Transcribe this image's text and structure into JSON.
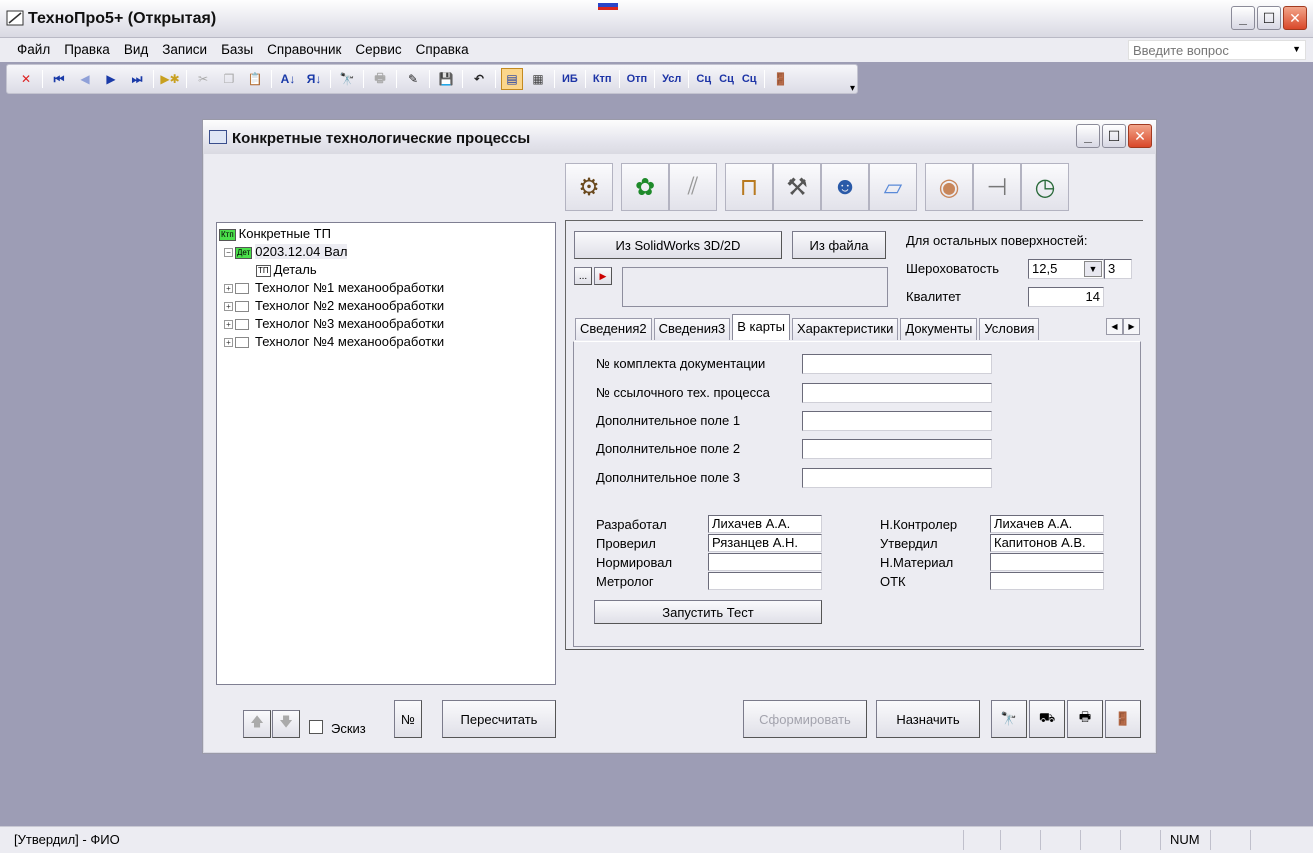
{
  "app": {
    "title": "ТехноПро5+ (Открытая)"
  },
  "menu": {
    "items": [
      "Файл",
      "Правка",
      "Вид",
      "Записи",
      "Базы",
      "Справочник",
      "Сервис",
      "Справка"
    ],
    "ask_placeholder": "Введите вопрос"
  },
  "toolbar": {
    "text_buttons": [
      "ИБ",
      "Ктп",
      "Отп",
      "Усл",
      "Сц",
      "Сц",
      "Сц"
    ]
  },
  "child": {
    "title": "Конкретные технологические процессы",
    "header_icons": [
      "part-icon",
      "gear-icon",
      "pipes-icon",
      "workbench-icon",
      "machine-icon",
      "worker-icon",
      "paper-icon",
      "roll-icon",
      "caliper-icon",
      "clock-icon"
    ]
  },
  "tree": {
    "root": {
      "badge": "Ктп",
      "label": "Конкретные ТП"
    },
    "detail": {
      "badge": "Дет",
      "label": "0203.12.04 Вал"
    },
    "tp": {
      "badge": "ТП",
      "label": "Деталь"
    },
    "technologists": [
      "Технолог №1 механообработки",
      "Технолог №2 механообработки",
      "Технолог №3 механообработки",
      "Технолог №4 механообработки"
    ]
  },
  "panel": {
    "from_solidworks": "Из SolidWorks 3D/2D",
    "from_file": "Из файла",
    "other_surfaces": "Для остальных поверхностей:",
    "roughness_label": "Шероховатость",
    "roughness_value": "12,5",
    "roughness_extra": "3",
    "qualitet_label": "Квалитет",
    "qualitet_value": "14",
    "dots": "...",
    "tabs": [
      "Сведения2",
      "Сведения3",
      "В карты",
      "Характеристики",
      "Документы",
      "Условия"
    ],
    "active_tab": "В карты"
  },
  "form": {
    "fields": [
      {
        "label": "№ комплекта документации",
        "value": ""
      },
      {
        "label": "№ ссылочного тех. процесса",
        "value": ""
      },
      {
        "label": "Дополнительное поле 1",
        "value": ""
      },
      {
        "label": "Дополнительное поле 2",
        "value": ""
      },
      {
        "label": "Дополнительное поле 3",
        "value": ""
      }
    ],
    "signers_left": [
      {
        "label": "Разработал",
        "value": "Лихачев А.А."
      },
      {
        "label": "Проверил",
        "value": "Рязанцев А.Н."
      },
      {
        "label": "Нормировал",
        "value": ""
      },
      {
        "label": "Метролог",
        "value": ""
      }
    ],
    "signers_right": [
      {
        "label": "Н.Контролер",
        "value": "Лихачев А.А."
      },
      {
        "label": "Утвердил",
        "value": "Капитонов А.В."
      },
      {
        "label": "Н.Материал",
        "value": ""
      },
      {
        "label": "ОТК",
        "value": ""
      }
    ],
    "run_test": "Запустить Тест"
  },
  "bottom": {
    "sketch": "Эскиз",
    "number": "№",
    "recalc": "Пересчитать",
    "generate": "Сформировать",
    "assign": "Назначить"
  },
  "status": {
    "left": "[Утвердил] - ФИО",
    "right": "NUM"
  },
  "colors": {
    "desktop": "#9d9db5",
    "window": "#ececf2",
    "close": "#d9482a",
    "badge_green": "#4be04b"
  }
}
